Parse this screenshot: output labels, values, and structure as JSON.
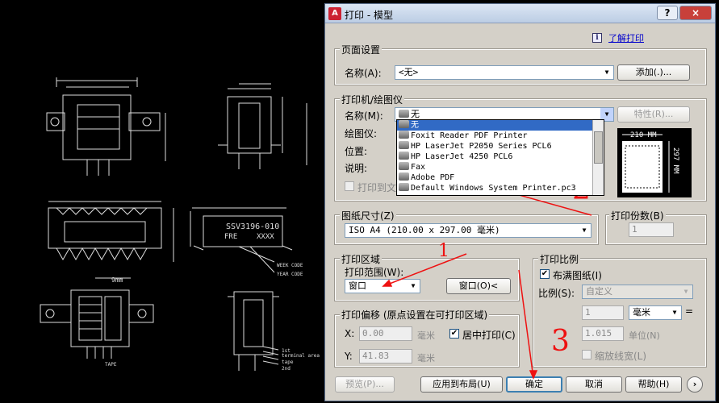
{
  "window": {
    "title": "打印 - 模型",
    "title_icon": "A",
    "help_glyph": "?",
    "close_glyph": "×"
  },
  "help_link": "了解打印",
  "page_setup": {
    "label": "页面设置",
    "name_label": "名称(A):",
    "name_value": "<无>",
    "add_button": "添加(.)..."
  },
  "printer": {
    "label": "打印机/绘图仪",
    "name_label": "名称(M):",
    "name_value": "无",
    "properties_button": "特性(R)...",
    "plotter_label": "绘图仪:",
    "location_label": "位置:",
    "description_label": "说明:",
    "print_to_file_label": "打印到文",
    "options": [
      "无",
      "Foxit Reader PDF Printer",
      "HP LaserJet P2050 Series PCL6",
      "HP LaserJet 4250 PCL6",
      "Fax",
      "Adobe PDF",
      "Default Windows System Printer.pc3"
    ]
  },
  "preview": {
    "width_label": "210 MM",
    "height_label": "297 MM"
  },
  "paper_size": {
    "label": "图纸尺寸(Z)",
    "value": "ISO A4 (210.00 x 297.00 毫米)"
  },
  "copies": {
    "label": "打印份数(B)",
    "value": "1"
  },
  "plot_area": {
    "label": "打印区域",
    "range_label": "打印范围(W):",
    "range_value": "窗口",
    "window_button": "窗口(O)<"
  },
  "plot_offset": {
    "label": "打印偏移 (原点设置在可打印区域)",
    "x_label": "X:",
    "x_value": "0.00",
    "x_unit": "毫米",
    "center_label": "居中打印(C)",
    "y_label": "Y:",
    "y_value": "41.83",
    "y_unit": "毫米"
  },
  "plot_scale": {
    "label": "打印比例",
    "fit_label": "布满图纸(I)",
    "scale_label": "比例(S):",
    "scale_value": "自定义",
    "value1": "1",
    "unit1": "毫米",
    "value2": "1.015",
    "unit2": "单位(N)",
    "lineweights_label": "缩放线宽(L)",
    "equals": "="
  },
  "footer": {
    "preview": "预览(P)...",
    "apply": "应用到布局(U)",
    "ok": "确定",
    "cancel": "取消",
    "help": "帮助(H)",
    "more": "›"
  },
  "annotations": {
    "a1": "1",
    "a2": "2",
    "a3": "3"
  },
  "cad": {
    "texts": [
      "SSV3196-010",
      "FRE",
      "XXXX",
      "WEEK CODE",
      "YEAR CODE",
      "TAPE",
      "1st",
      "terminal area",
      "tape",
      "2nd",
      "9mm"
    ]
  },
  "colors": {
    "accent": "#316ac5",
    "annotation": "#e11111"
  }
}
